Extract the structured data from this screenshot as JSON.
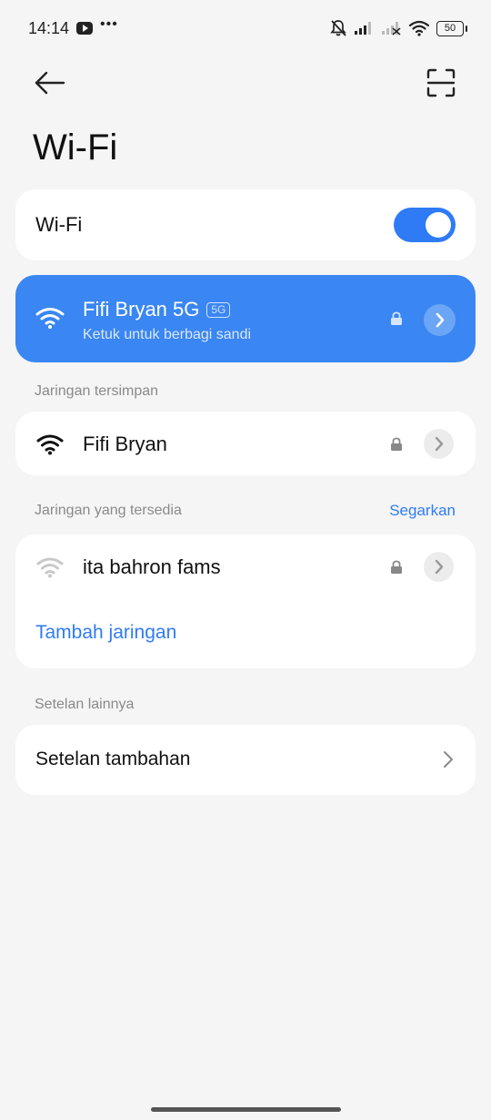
{
  "status_bar": {
    "time": "14:14",
    "dots": "•••",
    "battery": "50",
    "icons": [
      "youtube-icon",
      "bell-off-icon",
      "signal-icon",
      "signal-no-service-icon",
      "wifi-icon",
      "battery-icon"
    ]
  },
  "header": {
    "title": "Wi-Fi",
    "back_icon": "arrow-left-icon",
    "scan_icon": "scan-qr-icon"
  },
  "wifi_toggle": {
    "label": "Wi-Fi",
    "enabled": true
  },
  "connected": {
    "name": "Fifi Bryan 5G",
    "band": "5G",
    "subtitle": "Ketuk untuk berbagi sandi"
  },
  "saved_section": {
    "label": "Jaringan tersimpan",
    "networks": [
      {
        "name": "Fifi Bryan"
      }
    ]
  },
  "available_section": {
    "label": "Jaringan yang tersedia",
    "refresh_label": "Segarkan",
    "networks": [
      {
        "name": "ita bahron fams"
      }
    ],
    "add_network_label": "Tambah jaringan"
  },
  "more_section": {
    "label": "Setelan lainnya",
    "item_label": "Setelan tambahan"
  },
  "colors": {
    "accent": "#2f7bf6",
    "connected_bg": "#3a86f2",
    "background": "#f5f5f5"
  }
}
